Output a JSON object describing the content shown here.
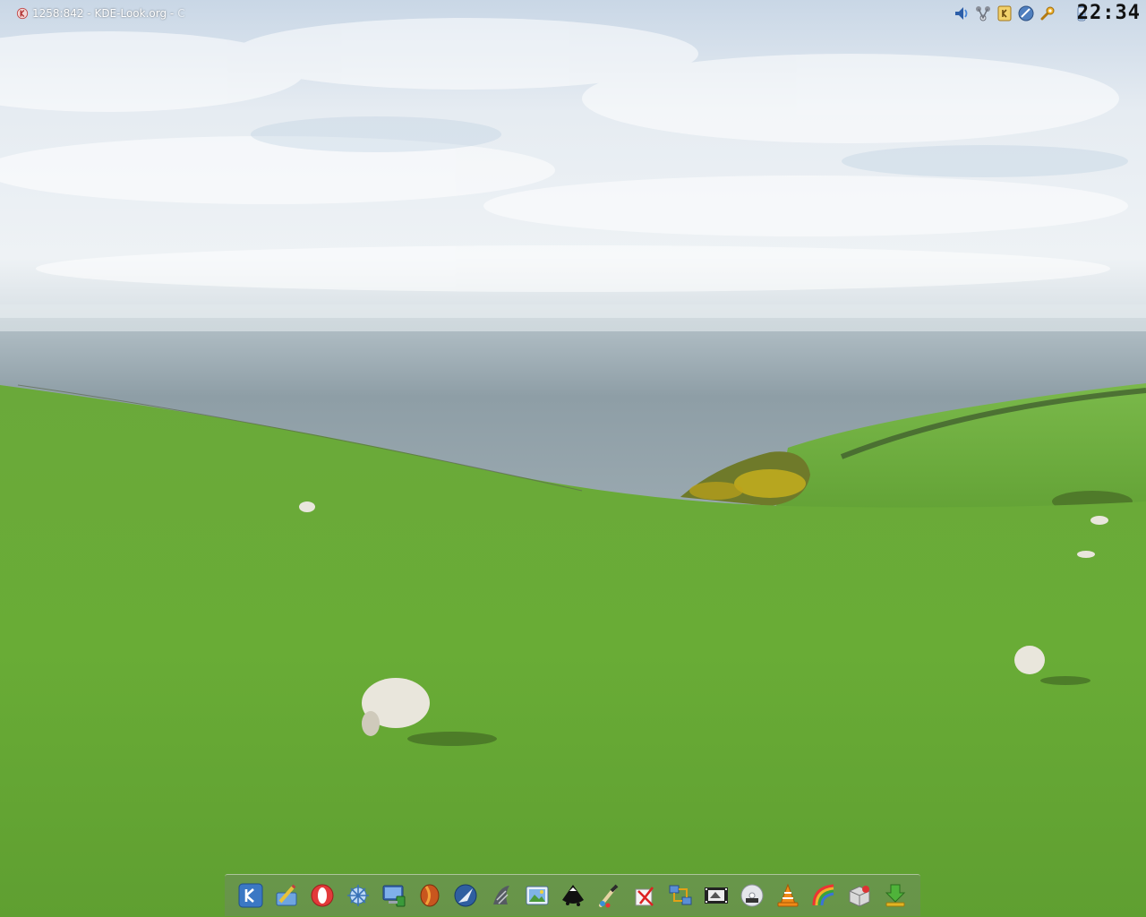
{
  "taskbar": {
    "active_task": {
      "label": "1258:842 - KDE-Look.org - ",
      "overflow_hint": "C",
      "icon": "konqueror-icon"
    },
    "system_tray": [
      {
        "name": "volume-icon"
      },
      {
        "name": "network-icon"
      },
      {
        "name": "klipper-icon"
      },
      {
        "name": "kopete-icon"
      },
      {
        "name": "settings-wrench-icon"
      },
      {
        "name": "battery-icon"
      }
    ],
    "clock": "22:34"
  },
  "dock": {
    "launchers": [
      {
        "name": "kde-menu-icon"
      },
      {
        "name": "kwrite-icon"
      },
      {
        "name": "opera-icon"
      },
      {
        "name": "kde-filemanager-icon"
      },
      {
        "name": "konsole-monitor-icon"
      },
      {
        "name": "firefox-icon"
      },
      {
        "name": "navigator-icon"
      },
      {
        "name": "wine-icon"
      },
      {
        "name": "image-viewer-icon"
      },
      {
        "name": "inkscape-icon"
      },
      {
        "name": "kolourpaint-icon"
      },
      {
        "name": "task-checklist-icon"
      },
      {
        "name": "network-transfer-icon"
      },
      {
        "name": "video-editor-icon"
      },
      {
        "name": "dvd-icon"
      },
      {
        "name": "vlc-icon"
      },
      {
        "name": "rainbow-theme-icon"
      },
      {
        "name": "package-manager-icon"
      },
      {
        "name": "download-icon"
      }
    ]
  },
  "colors": {
    "sky": "#dce6ef",
    "sea": "#8fa0a8",
    "grass": "#6cac3a",
    "dock_bg": "#7a8a7a"
  }
}
